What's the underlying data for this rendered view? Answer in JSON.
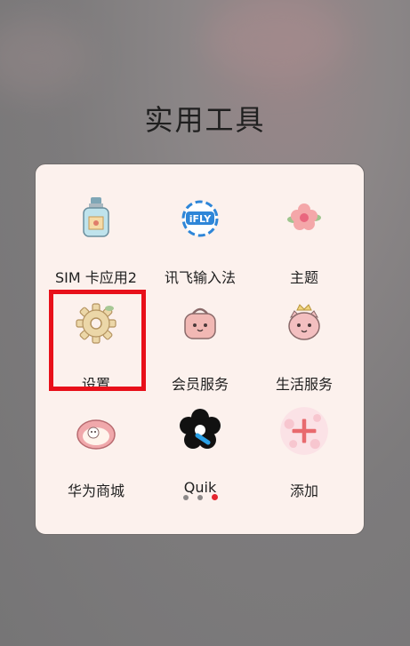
{
  "folder": {
    "title": "实用工具"
  },
  "apps": [
    {
      "label": "SIM 卡应用2",
      "icon": "sim-bottle-icon"
    },
    {
      "label": "讯飞输入法",
      "icon": "ifly-icon",
      "icon_text": "iFLY"
    },
    {
      "label": "主题",
      "icon": "flower-theme-icon"
    },
    {
      "label": "设置",
      "icon": "gear-icon"
    },
    {
      "label": "会员服务",
      "icon": "cat-bag-icon"
    },
    {
      "label": "生活服务",
      "icon": "crown-cat-icon"
    },
    {
      "label": "华为商城",
      "icon": "cat-bed-icon"
    },
    {
      "label": "Quik",
      "icon": "quik-flower-icon"
    },
    {
      "label": "添加",
      "icon": "add-icon"
    }
  ],
  "pager": {
    "count": 3,
    "active": 3
  },
  "colors": {
    "highlight": "#e8101a",
    "panel": "#fcf1ed",
    "active_dot": "#e5262f"
  }
}
